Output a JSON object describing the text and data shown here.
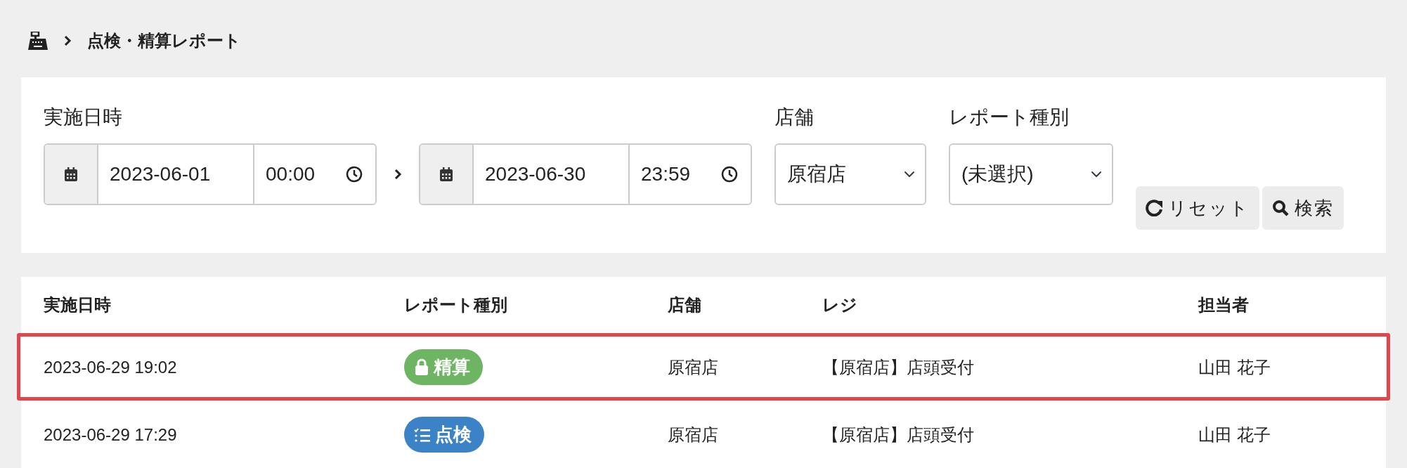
{
  "breadcrumb": {
    "title": "点検・精算レポート"
  },
  "filters": {
    "date_label": "実施日時",
    "from": {
      "date": "2023-06-01",
      "time": "00:00"
    },
    "to": {
      "date": "2023-06-30",
      "time": "23:59"
    },
    "store": {
      "label": "店舗",
      "value": "原宿店"
    },
    "report_type": {
      "label": "レポート種別",
      "value": "(未選択)"
    },
    "buttons": [
      {
        "kind": "reset",
        "label": "リセット"
      },
      {
        "kind": "search",
        "label": "検索"
      }
    ]
  },
  "table": {
    "columns": [
      "実施日時",
      "レポート種別",
      "店舗",
      "レジ",
      "担当者"
    ],
    "rows": [
      {
        "datetime": "2023-06-29 19:02",
        "type": {
          "kind": "lock",
          "label": "精算",
          "color": "#6db562"
        },
        "store": "原宿店",
        "register": "【原宿店】店頭受付",
        "staff": "山田 花子",
        "highlighted": true
      },
      {
        "datetime": "2023-06-29 17:29",
        "type": {
          "kind": "checklist",
          "label": "点検",
          "color": "#3b83c6"
        },
        "store": "原宿店",
        "register": "【原宿店】店頭受付",
        "staff": "山田 花子",
        "highlighted": false
      }
    ]
  }
}
